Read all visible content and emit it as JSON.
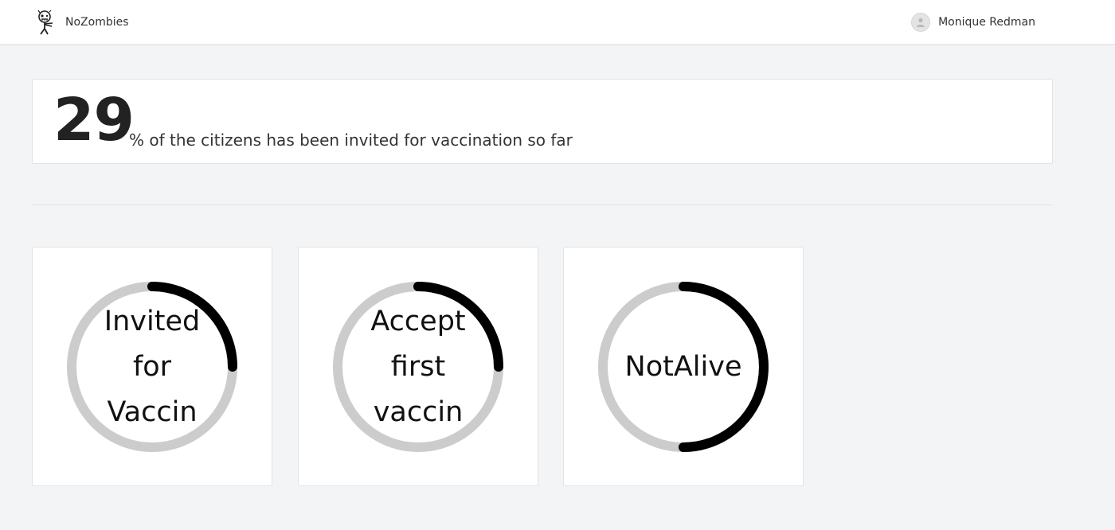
{
  "app": {
    "name": "NoZombies",
    "logo_icon": "zombie-logo-icon"
  },
  "user": {
    "name": "Monique Redman",
    "avatar_icon": "user-avatar-icon"
  },
  "summary": {
    "value": "29",
    "caption": "% of the citizens has been invited for vaccination so far"
  },
  "gauges": [
    {
      "label": "Invited for Vaccin",
      "fraction": 0.25
    },
    {
      "label": "Accept first vaccin",
      "fraction": 0.25
    },
    {
      "label": "NotAlive",
      "fraction": 0.5
    }
  ],
  "colors": {
    "track": "#cccccc",
    "progress": "#000000",
    "background": "#f3f4f6",
    "card": "#ffffff"
  }
}
